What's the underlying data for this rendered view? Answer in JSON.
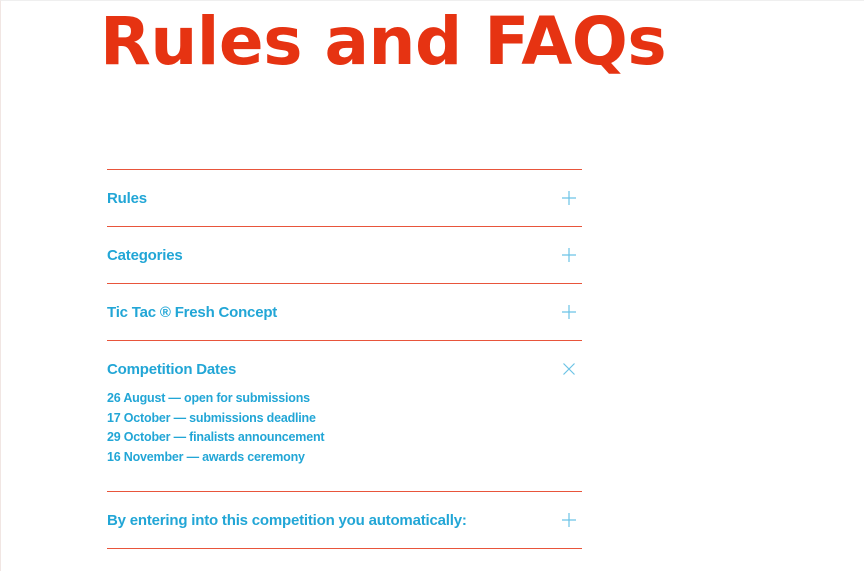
{
  "page": {
    "title": "Rules and FAQs"
  },
  "colors": {
    "accent_red": "#e63312",
    "divider_red": "#e8553b",
    "accent_blue": "#22a6d6"
  },
  "accordion": {
    "items": [
      {
        "label": "Rules",
        "expanded": false,
        "icon": "plus-icon"
      },
      {
        "label": "Categories",
        "expanded": false,
        "icon": "plus-icon"
      },
      {
        "label": "Tic Tac ® Fresh Concept",
        "expanded": false,
        "icon": "plus-icon"
      },
      {
        "label": "Competition Dates",
        "expanded": true,
        "icon": "close-icon",
        "content": [
          "26 August — open for submissions",
          "17 October — submissions deadline",
          "29 October — finalists announcement",
          "16 November — awards ceremony"
        ]
      },
      {
        "label": "By entering into this competition you automatically:",
        "expanded": false,
        "icon": "plus-icon"
      }
    ]
  }
}
